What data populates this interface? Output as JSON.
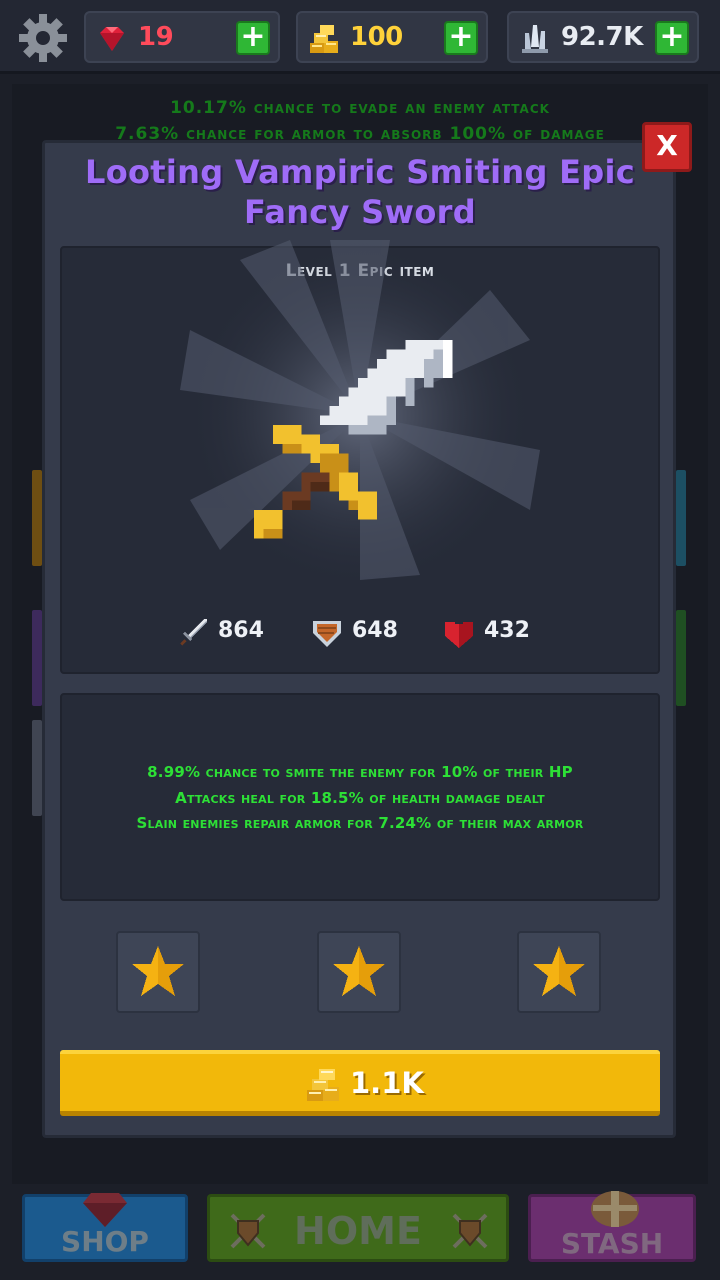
{
  "topbar": {
    "gems": "19",
    "gold": "100",
    "crystals": "92.7K",
    "plus_label": "+"
  },
  "background": {
    "line1": "10.17% chance to evade an enemy attack",
    "line2": "7.63% chance for armor to absorb 100% of damage"
  },
  "modal": {
    "close_label": "X",
    "title_line1": "Looting Vampiric Smiting Epic",
    "title_line2": "Fancy Sword",
    "item_level": "Level 1 Epic item",
    "stats": {
      "attack": "864",
      "armor": "648",
      "health": "432"
    },
    "effects": [
      "8.99% chance to smite the enemy for 10% of their HP",
      "Attacks heal for 18.5% of health damage dealt",
      "Slain enemies repair armor for 7.24% of their max armor"
    ],
    "stars_filled": 3,
    "price": "1.1K"
  },
  "nav": {
    "shop": "SHOP",
    "home": "HOME",
    "stash": "STASH"
  },
  "colors": {
    "title": "#9f6cf7",
    "effect_text": "#2de036",
    "buy_button": "#f2b80a",
    "close_button": "#cc2828"
  }
}
